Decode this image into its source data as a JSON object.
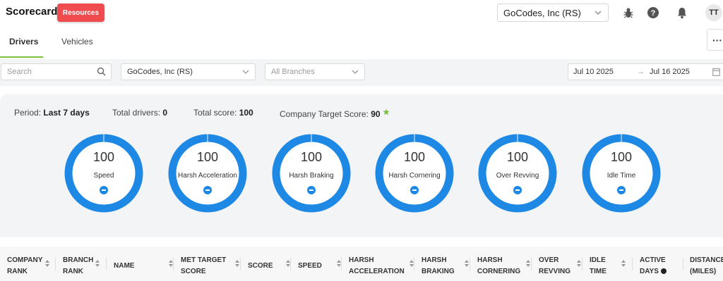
{
  "header": {
    "app_title": "Scorecard",
    "resources_label": "Resources",
    "company_selected": "GoCodes, Inc (RS)",
    "avatar_initials": "TT",
    "icons": [
      "bug-icon",
      "help-icon",
      "bell-icon"
    ]
  },
  "tabs": [
    {
      "label": "Drivers",
      "active": true
    },
    {
      "label": "Vehicles",
      "active": false
    }
  ],
  "more_label": "···",
  "filters": {
    "search_placeholder": "Search",
    "company_value": "GoCodes, Inc (RS)",
    "branches_placeholder": "All Branches",
    "date_from": "Jul 10 2025",
    "date_to": "Jul 16 2025",
    "date_arrow": "→"
  },
  "summary": {
    "period_label": "Period:",
    "period_value": "Last 7 days",
    "drivers_label": "Total drivers:",
    "drivers_value": "0",
    "score_label": "Total score:",
    "score_value": "100",
    "target_label": "Company Target Score:",
    "target_value": "90",
    "target_icon": "star-icon",
    "accent_color": "#7cc042"
  },
  "gauge_color": "#1e88e5",
  "gauges": [
    {
      "value": "100",
      "label": "Speed"
    },
    {
      "value": "100",
      "label": "Harsh Acceleration"
    },
    {
      "value": "100",
      "label": "Harsh Braking"
    },
    {
      "value": "100",
      "label": "Harsh Cornering"
    },
    {
      "value": "100",
      "label": "Over Revving"
    },
    {
      "value": "100",
      "label": "Idle Time"
    }
  ],
  "table": {
    "columns": [
      {
        "line1": "COMPANY",
        "line2": "RANK"
      },
      {
        "line1": "BRANCH",
        "line2": "RANK"
      },
      {
        "line1": "NAME",
        "line2": ""
      },
      {
        "line1": "MET TARGET",
        "line2": "SCORE"
      },
      {
        "line1": "SCORE",
        "line2": ""
      },
      {
        "line1": "SPEED",
        "line2": ""
      },
      {
        "line1": "HARSH",
        "line2": "ACCELERATION"
      },
      {
        "line1": "HARSH",
        "line2": "BRAKING"
      },
      {
        "line1": "HARSH",
        "line2": "CORNERING"
      },
      {
        "line1": "OVER",
        "line2": "REVVING"
      },
      {
        "line1": "IDLE",
        "line2": "TIME"
      },
      {
        "line1": "ACTIVE",
        "line2": "DAYS"
      },
      {
        "line1": "DISTANCE",
        "line2": "(MILES)"
      }
    ]
  }
}
